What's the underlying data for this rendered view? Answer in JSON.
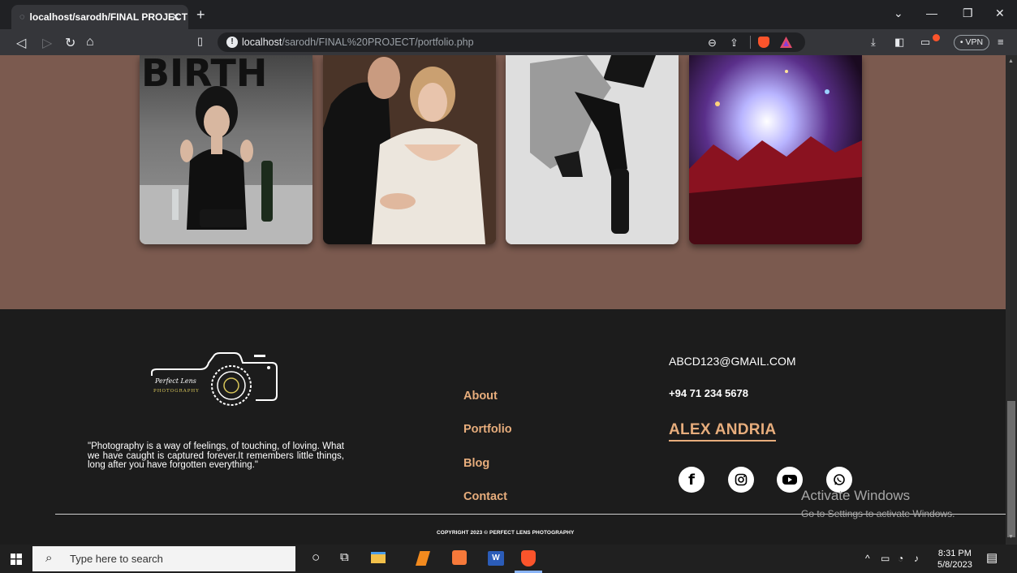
{
  "browser": {
    "tab_title": "localhost/sarodh/FINAL PROJECT",
    "tab_close": "✕",
    "new_tab": "+",
    "url_host": "localhost",
    "url_path": "/sarodh/FINAL%20PROJECT/portfolio.php",
    "vpn_label": "• VPN"
  },
  "gallery": {
    "background": "#7b5a4f",
    "photos": [
      {
        "alt": "birthday-photo"
      },
      {
        "alt": "wedding-photo"
      },
      {
        "alt": "fashion-photo"
      },
      {
        "alt": "concert-photo"
      }
    ]
  },
  "footer": {
    "logo_text": "Perfect Lens",
    "logo_subtext": "PHOTOGRAPHY",
    "quote": "\"Photography is a way of feelings, of touching, of loving. What we have caught is captured forever.It remembers little things, long after you have forgotten everything.\"",
    "nav": [
      {
        "label": "About"
      },
      {
        "label": "Portfolio"
      },
      {
        "label": "Blog"
      },
      {
        "label": "Contact"
      }
    ],
    "email": "ABCD123@GMAIL.COM",
    "phone": "+94 71 234 5678",
    "name": "ALEX ANDRIA",
    "social": [
      "facebook-icon",
      "instagram-icon",
      "youtube-icon",
      "whatsapp-icon"
    ],
    "copyright": "COPYRIGHT 2023 © PERFECT LENS PHOTOGRAPHY",
    "accent": "#e7ad7c"
  },
  "watermark": {
    "title": "Activate Windows",
    "subtitle": "Go to Settings to activate Windows."
  },
  "taskbar": {
    "search_placeholder": "Type here to search",
    "time": "8:31 PM",
    "date": "5/8/2023"
  }
}
